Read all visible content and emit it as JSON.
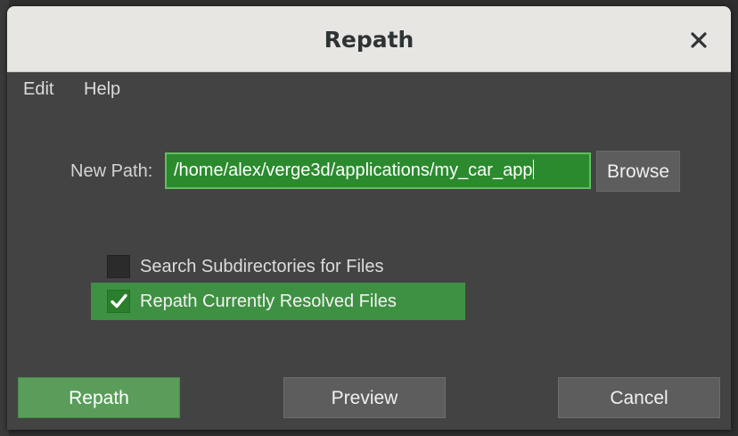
{
  "dialog": {
    "title": "Repath"
  },
  "menu": {
    "items": [
      {
        "label": "Edit"
      },
      {
        "label": "Help"
      }
    ]
  },
  "path": {
    "label": "New Path:",
    "value": "/home/alex/verge3d/applications/my_car_app",
    "browse_label": "Browse"
  },
  "options": [
    {
      "label": "Search Subdirectories for Files",
      "checked": false
    },
    {
      "label": "Repath Currently Resolved Files",
      "checked": true
    }
  ],
  "buttons": {
    "repath": "Repath",
    "preview": "Preview",
    "cancel": "Cancel"
  },
  "colors": {
    "accent_green": "#3e9142",
    "input_green": "#2c8a2e",
    "primary_button": "#5a9d5b",
    "titlebar": "#e8e6e3",
    "dialog_bg": "#434343"
  },
  "icons": {
    "close": "close-icon",
    "check": "checkmark-icon"
  }
}
